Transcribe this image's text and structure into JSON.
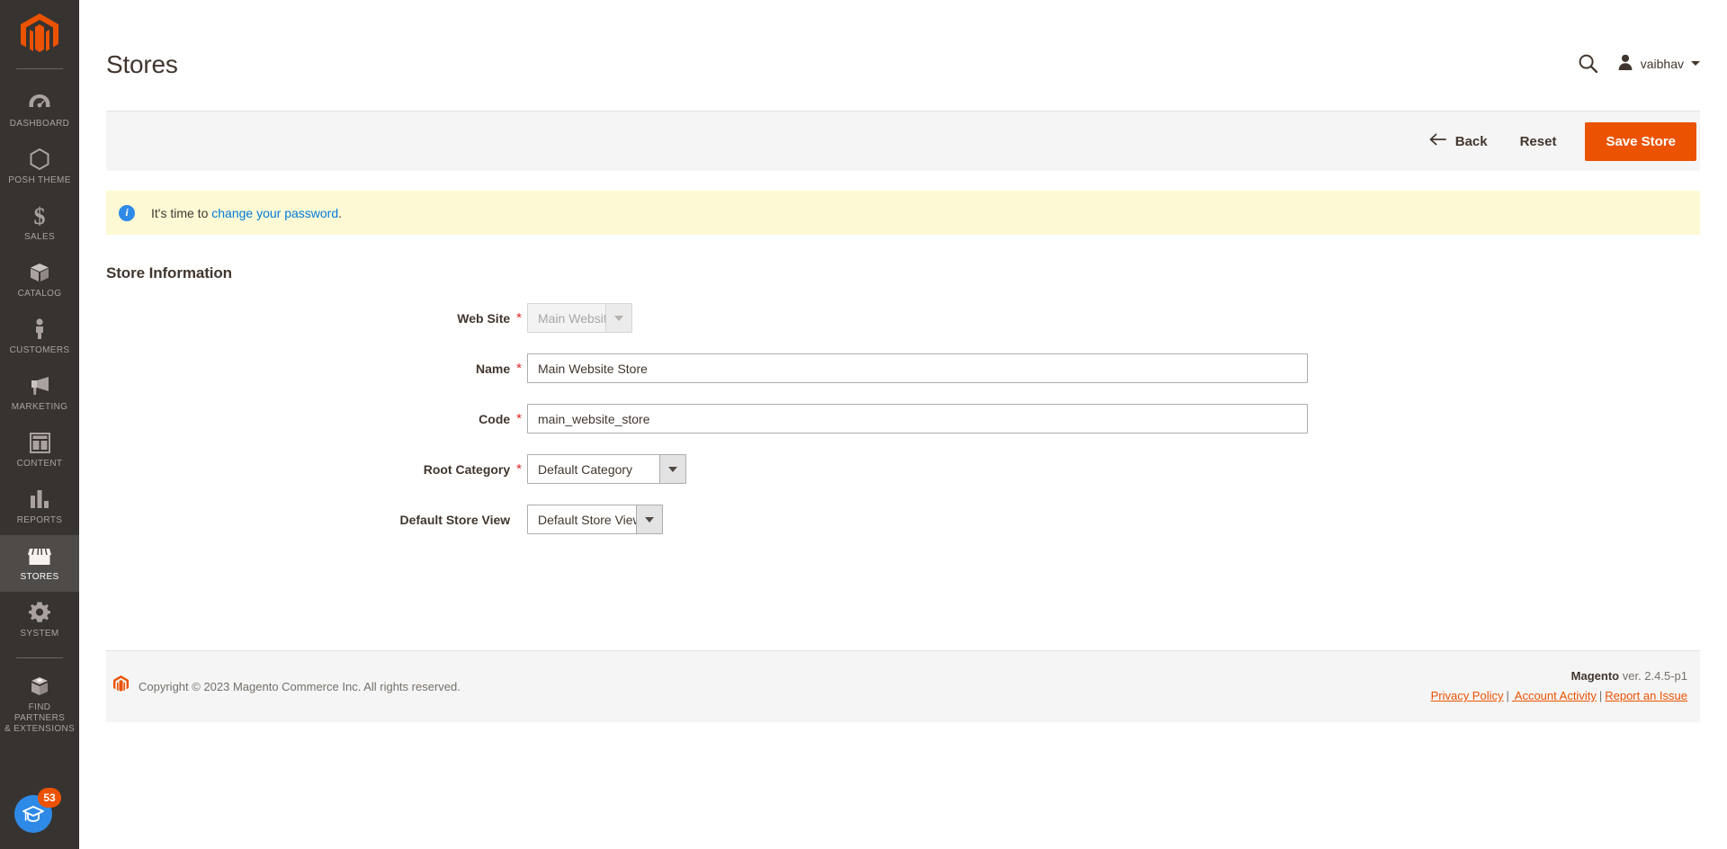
{
  "sidebar": {
    "logo": "magento-logo",
    "items": [
      {
        "label": "Dashboard",
        "icon": "dashboard-icon",
        "active": false
      },
      {
        "label": "Posh Theme",
        "icon": "hexagon-icon",
        "active": false
      },
      {
        "label": "Sales",
        "icon": "dollar-icon",
        "active": false
      },
      {
        "label": "Catalog",
        "icon": "box-icon",
        "active": false
      },
      {
        "label": "Customers",
        "icon": "person-icon",
        "active": false
      },
      {
        "label": "Marketing",
        "icon": "megaphone-icon",
        "active": false
      },
      {
        "label": "Content",
        "icon": "layout-icon",
        "active": false
      },
      {
        "label": "Reports",
        "icon": "bar-chart-icon",
        "active": false
      },
      {
        "label": "Stores",
        "icon": "storefront-icon",
        "active": true
      },
      {
        "label": "System",
        "icon": "gear-icon",
        "active": false
      },
      {
        "label": "Find Partners\n& Extensions",
        "icon": "partners-box-icon",
        "active": false
      }
    ],
    "help_widget": {
      "badge_count": "53",
      "icon": "graduation-cap-icon"
    }
  },
  "header": {
    "title": "Stores",
    "search_icon": "search-icon",
    "user_icon": "user-avatar-icon",
    "user_name": "vaibhav",
    "caret_icon": "chevron-down-icon"
  },
  "actions": {
    "back_label": "Back",
    "back_icon": "arrow-left-icon",
    "reset_label": "Reset",
    "save_label": "Save Store",
    "save_color": "#eb5202"
  },
  "message": {
    "icon": "info-icon",
    "icon_glyph": "i",
    "text_before": "It's time to ",
    "link_text": "change your password",
    "text_after": ".",
    "background": "#fdf9d4",
    "link_color": "#007bdb"
  },
  "form": {
    "section_title": "Store Information",
    "fields": [
      {
        "label": "Web Site",
        "required": true,
        "type": "select",
        "value": "Main Website",
        "disabled": true
      },
      {
        "label": "Name",
        "required": true,
        "type": "text",
        "value": "Main Website Store",
        "placeholder": ""
      },
      {
        "label": "Code",
        "required": true,
        "type": "text",
        "value": "main_website_store",
        "placeholder": ""
      },
      {
        "label": "Root Category",
        "required": true,
        "type": "select",
        "value": "Default Category",
        "disabled": false
      },
      {
        "label": "Default Store View",
        "required": false,
        "type": "select",
        "value": "Default Store View",
        "disabled": false
      }
    ]
  },
  "footer": {
    "logo": "magento-mark-icon",
    "copyright": "Copyright © 2023 Magento Commerce Inc. All rights reserved.",
    "brand": "Magento",
    "version": " ver. 2.4.5-p1",
    "links": [
      {
        "label": "Privacy Policy"
      },
      {
        "label": " Account Activity"
      },
      {
        "label": "Report an Issue"
      }
    ],
    "separator": "|"
  }
}
